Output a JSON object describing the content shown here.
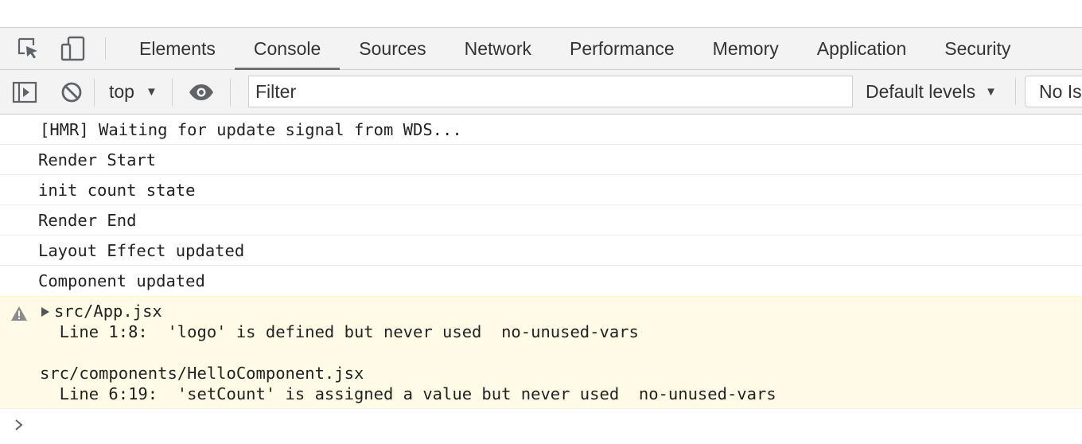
{
  "tabs": [
    {
      "label": "Elements",
      "active": false
    },
    {
      "label": "Console",
      "active": true
    },
    {
      "label": "Sources",
      "active": false
    },
    {
      "label": "Network",
      "active": false
    },
    {
      "label": "Performance",
      "active": false
    },
    {
      "label": "Memory",
      "active": false
    },
    {
      "label": "Application",
      "active": false
    },
    {
      "label": "Security",
      "active": false
    }
  ],
  "toolbar": {
    "context": "top",
    "filter_placeholder": "Filter",
    "levels": "Default levels",
    "issues": "No Is"
  },
  "messages": [
    "[HMR] Waiting for update signal from WDS...",
    "Render Start",
    "init count state",
    "Render End",
    "Layout Effect updated",
    "Component updated"
  ],
  "warning": {
    "file1": "src/App.jsx",
    "detail1": "  Line 1:8:  'logo' is defined but never used  no-unused-vars",
    "file2": "src/components/HelloComponent.jsx",
    "detail2": "  Line 6:19:  'setCount' is assigned a value but never used  no-unused-vars"
  },
  "icons": {
    "inspect": "inspect-element-icon",
    "device": "device-toolbar-icon",
    "sidebar": "console-sidebar-icon",
    "clear": "clear-console-icon",
    "eye": "live-expression-icon",
    "warning": "warning-icon",
    "prompt": "prompt-chevron-icon"
  },
  "colors": {
    "toolbar_bg": "#f3f3f3",
    "warning_bg": "#fffbe6",
    "active_tab_underline": "#6f6f6f"
  }
}
